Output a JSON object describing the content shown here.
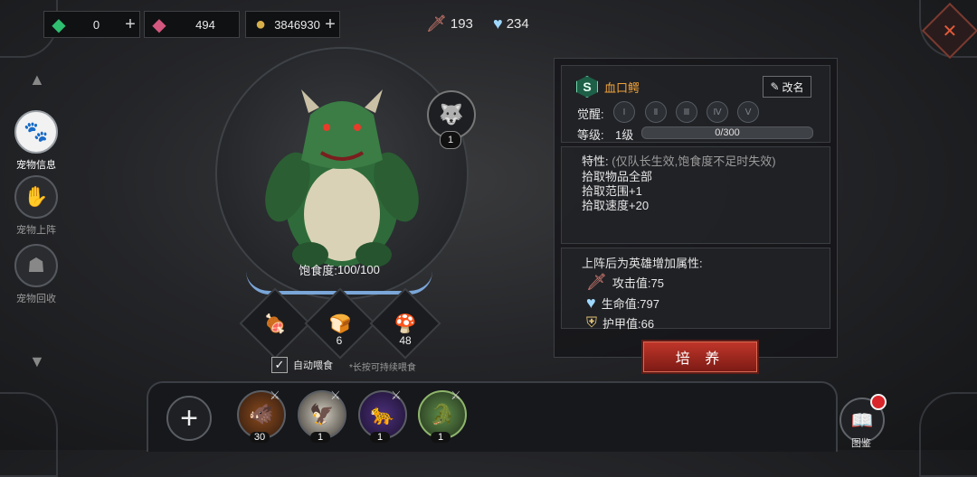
{
  "currency": [
    {
      "icon": "green-gem-icon",
      "value": "0",
      "has_plus": true
    },
    {
      "icon": "pink-gem-icon",
      "value": "494",
      "has_plus": false
    },
    {
      "icon": "gold-coins-icon",
      "value": "3846930",
      "has_plus": true
    }
  ],
  "plus_glyph": "+",
  "top_stats": {
    "attack": "193",
    "health": "234"
  },
  "nav": [
    {
      "label": "宠物信息",
      "icon": "paw-icon",
      "active": true
    },
    {
      "label": "宠物上阵",
      "icon": "claw-icon",
      "active": false
    },
    {
      "label": "宠物回收",
      "icon": "recycle-beast-icon",
      "active": false
    }
  ],
  "pet": {
    "fullness_label": "饱食度:",
    "fullness_value": "100/100",
    "fullness_fraction": 1.0,
    "badge_count": "1"
  },
  "food": [
    {
      "icon": "food-meat-icon",
      "count": ""
    },
    {
      "icon": "food-bread-icon",
      "count": "6"
    },
    {
      "icon": "food-mushroom-icon",
      "count": "48"
    }
  ],
  "auto_feed": {
    "label": "自动喂食",
    "checked": true,
    "hint": "*长按可持续喂食"
  },
  "info": {
    "grade": "S",
    "name": "血口鳄",
    "rename": "改名",
    "awaken_label": "觉醒:",
    "awaken_levels": [
      "Ⅰ",
      "Ⅱ",
      "Ⅲ",
      "Ⅳ",
      "Ⅴ"
    ],
    "level_label": "等级:",
    "level_value": "1级",
    "exp": "0/300"
  },
  "traits": {
    "title": "特性:",
    "note": "(仅队长生效,饱食度不足时失效)",
    "lines": [
      "拾取物品全部",
      "拾取范围+1",
      "拾取速度+20"
    ]
  },
  "attrs": {
    "title": "上阵后为英雄增加属性:",
    "rows": [
      {
        "icon": "sword-icon",
        "text": "攻击值:75"
      },
      {
        "icon": "heart-icon",
        "text": "生命值:797"
      },
      {
        "icon": "armor-icon",
        "text": "护甲值:66"
      }
    ]
  },
  "train_button": "培 养",
  "pet_slots": [
    {
      "icon": "boar-pet-icon",
      "count": "30"
    },
    {
      "icon": "eagle-pet-icon",
      "count": "1"
    },
    {
      "icon": "panther-pet-icon",
      "count": "1"
    },
    {
      "icon": "crocodile-pet-icon",
      "count": "1"
    }
  ],
  "codex": {
    "label": "图鉴",
    "has_notification": true
  }
}
